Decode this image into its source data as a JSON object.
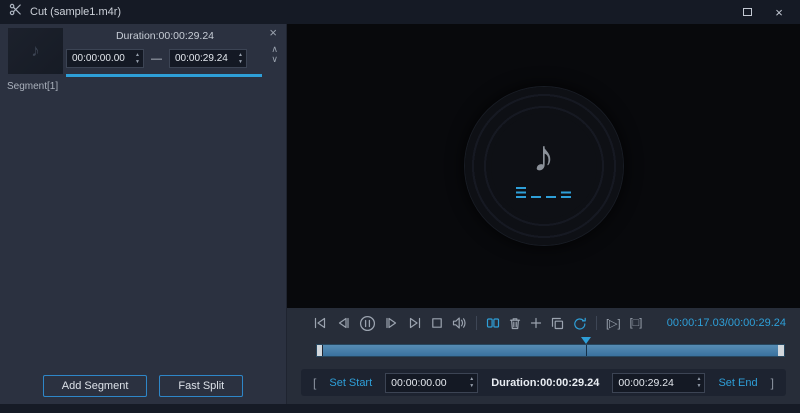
{
  "colors": {
    "accent": "#2e9fd8",
    "titlebar_bg": "#151a25",
    "panel_bg": "#2b3140",
    "preview_bg": "#08090c",
    "icon_gray": "#9ba3af"
  },
  "icons": {
    "spin_up": "▲",
    "spin_down": "▼",
    "move_up": "∧",
    "move_down": "∨",
    "close": "×",
    "remove_segment": "×",
    "note": "♪",
    "play_section": "[▷]",
    "stop_section": "[□]",
    "dash": "—"
  },
  "titlebar": {
    "title": "Cut (sample1.m4r)"
  },
  "left_panel": {
    "duration_label": "Duration:00:00:29.24",
    "start_value": "00:00:00.00",
    "end_value": "00:00:29.24",
    "segment_label": "Segment[1]",
    "add_segment_label": "Add Segment",
    "fast_split_label": "Fast Split"
  },
  "controls": {
    "time_display": "00:00:17.03/00:00:29.24"
  },
  "timeline": {
    "progress_percent": 57.5
  },
  "set_row": {
    "left_bracket": "[",
    "set_start_label": "Set Start",
    "start_value": "00:00:00.00",
    "duration_label": "Duration:00:00:29.24",
    "end_value": "00:00:29.24",
    "set_end_label": "Set End",
    "right_bracket": "]"
  }
}
